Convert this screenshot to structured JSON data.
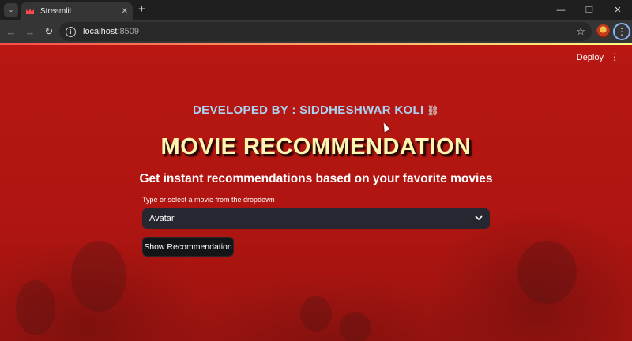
{
  "browser": {
    "tab_title": "Streamlit",
    "url_host": "localhost",
    "url_port": ":8509",
    "new_tab_glyph": "+",
    "close_glyph": "✕"
  },
  "app": {
    "deploy_label": "Deploy",
    "developer_credit": "DEVELOPED BY : SIDDHESHWAR KOLI",
    "title": "MOVIE RECOMMENDATION",
    "subtitle": "Get instant recommendations based on your favorite movies",
    "select": {
      "label": "Type or select a movie from the dropdown",
      "value": "Avatar"
    },
    "button_label": "Show Recommendation"
  },
  "colors": {
    "background": "#b81712",
    "title": "#fff4b0",
    "credit": "#a9d3f2",
    "select_bg": "#262730",
    "button_bg": "#141519"
  },
  "icons": {
    "favicon": "streamlit-crown-icon",
    "link": "link-icon",
    "dropdown": "chevron-down-icon",
    "menu": "kebab-menu-icon"
  }
}
